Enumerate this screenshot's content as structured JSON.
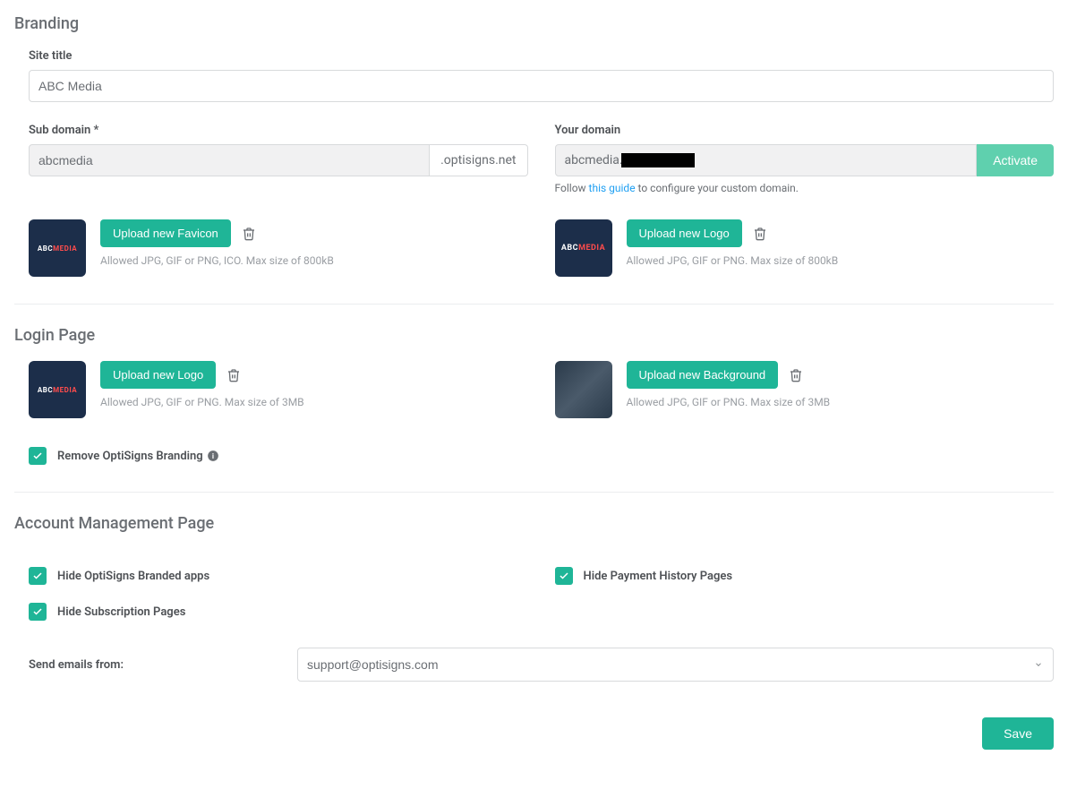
{
  "branding": {
    "title": "Branding",
    "siteTitle": {
      "label": "Site title",
      "value": "ABC Media"
    },
    "subDomain": {
      "label": "Sub domain *",
      "value": "abcmedia",
      "suffix": ".optisigns.net"
    },
    "yourDomain": {
      "label": "Your domain",
      "valuePrefix": "abcmedia.",
      "activate": "Activate",
      "helperPre": "Follow ",
      "helperLink": "this guide",
      "helperPost": " to configure your custom domain."
    },
    "favicon": {
      "button": "Upload new Favicon",
      "allowed": "Allowed JPG, GIF or PNG, ICO. Max size of 800kB"
    },
    "logo": {
      "button": "Upload new Logo",
      "allowed": "Allowed JPG, GIF or PNG. Max size of 800kB"
    }
  },
  "loginPage": {
    "title": "Login Page",
    "logo": {
      "button": "Upload new Logo",
      "allowed": "Allowed JPG, GIF or PNG. Max size of 3MB"
    },
    "background": {
      "button": "Upload new Background",
      "allowed": "Allowed JPG, GIF or PNG. Max size of 3MB"
    },
    "removeBranding": {
      "label": "Remove OptiSigns Branding",
      "checked": true
    }
  },
  "account": {
    "title": "Account Management Page",
    "checkboxes": {
      "hideApps": {
        "label": "Hide OptiSigns Branded apps",
        "checked": true
      },
      "hidePayment": {
        "label": "Hide Payment History Pages",
        "checked": true
      },
      "hideSubscription": {
        "label": "Hide Subscription Pages",
        "checked": true
      }
    },
    "emailFrom": {
      "label": "Send emails from:",
      "value": "support@optisigns.com"
    }
  },
  "save": "Save",
  "thumbText": {
    "abc": "ABC",
    "media": "MEDIA"
  }
}
